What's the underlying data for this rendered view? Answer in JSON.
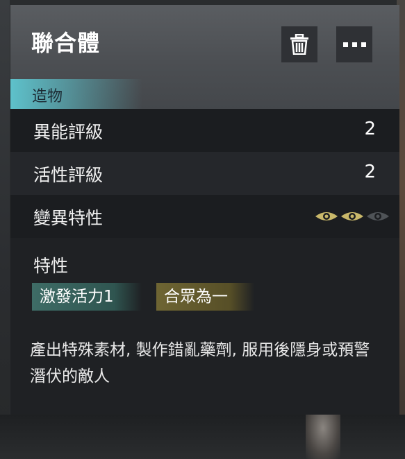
{
  "card": {
    "title": "聯合體",
    "category": "造物",
    "buttons": {
      "trash_icon": "trash-icon",
      "more_icon": "more-icon"
    }
  },
  "stats": [
    {
      "label": "異能評級",
      "value": "2"
    },
    {
      "label": "活性評級",
      "value": "2"
    }
  ],
  "mutation": {
    "label": "變異特性",
    "eyes_total": 3,
    "eyes_active": 2,
    "active_color": "#c9b86a",
    "inactive_color": "#4f5357"
  },
  "traits": {
    "label": "特性",
    "tags": [
      {
        "text": "激發活力1",
        "color": "#3e6c66"
      },
      {
        "text": "合眾為一",
        "color": "#6e6533"
      }
    ]
  },
  "description": "產出特殊素材, 製作錯亂藥劑, 服用後隱身或預警潛伏的敵人"
}
